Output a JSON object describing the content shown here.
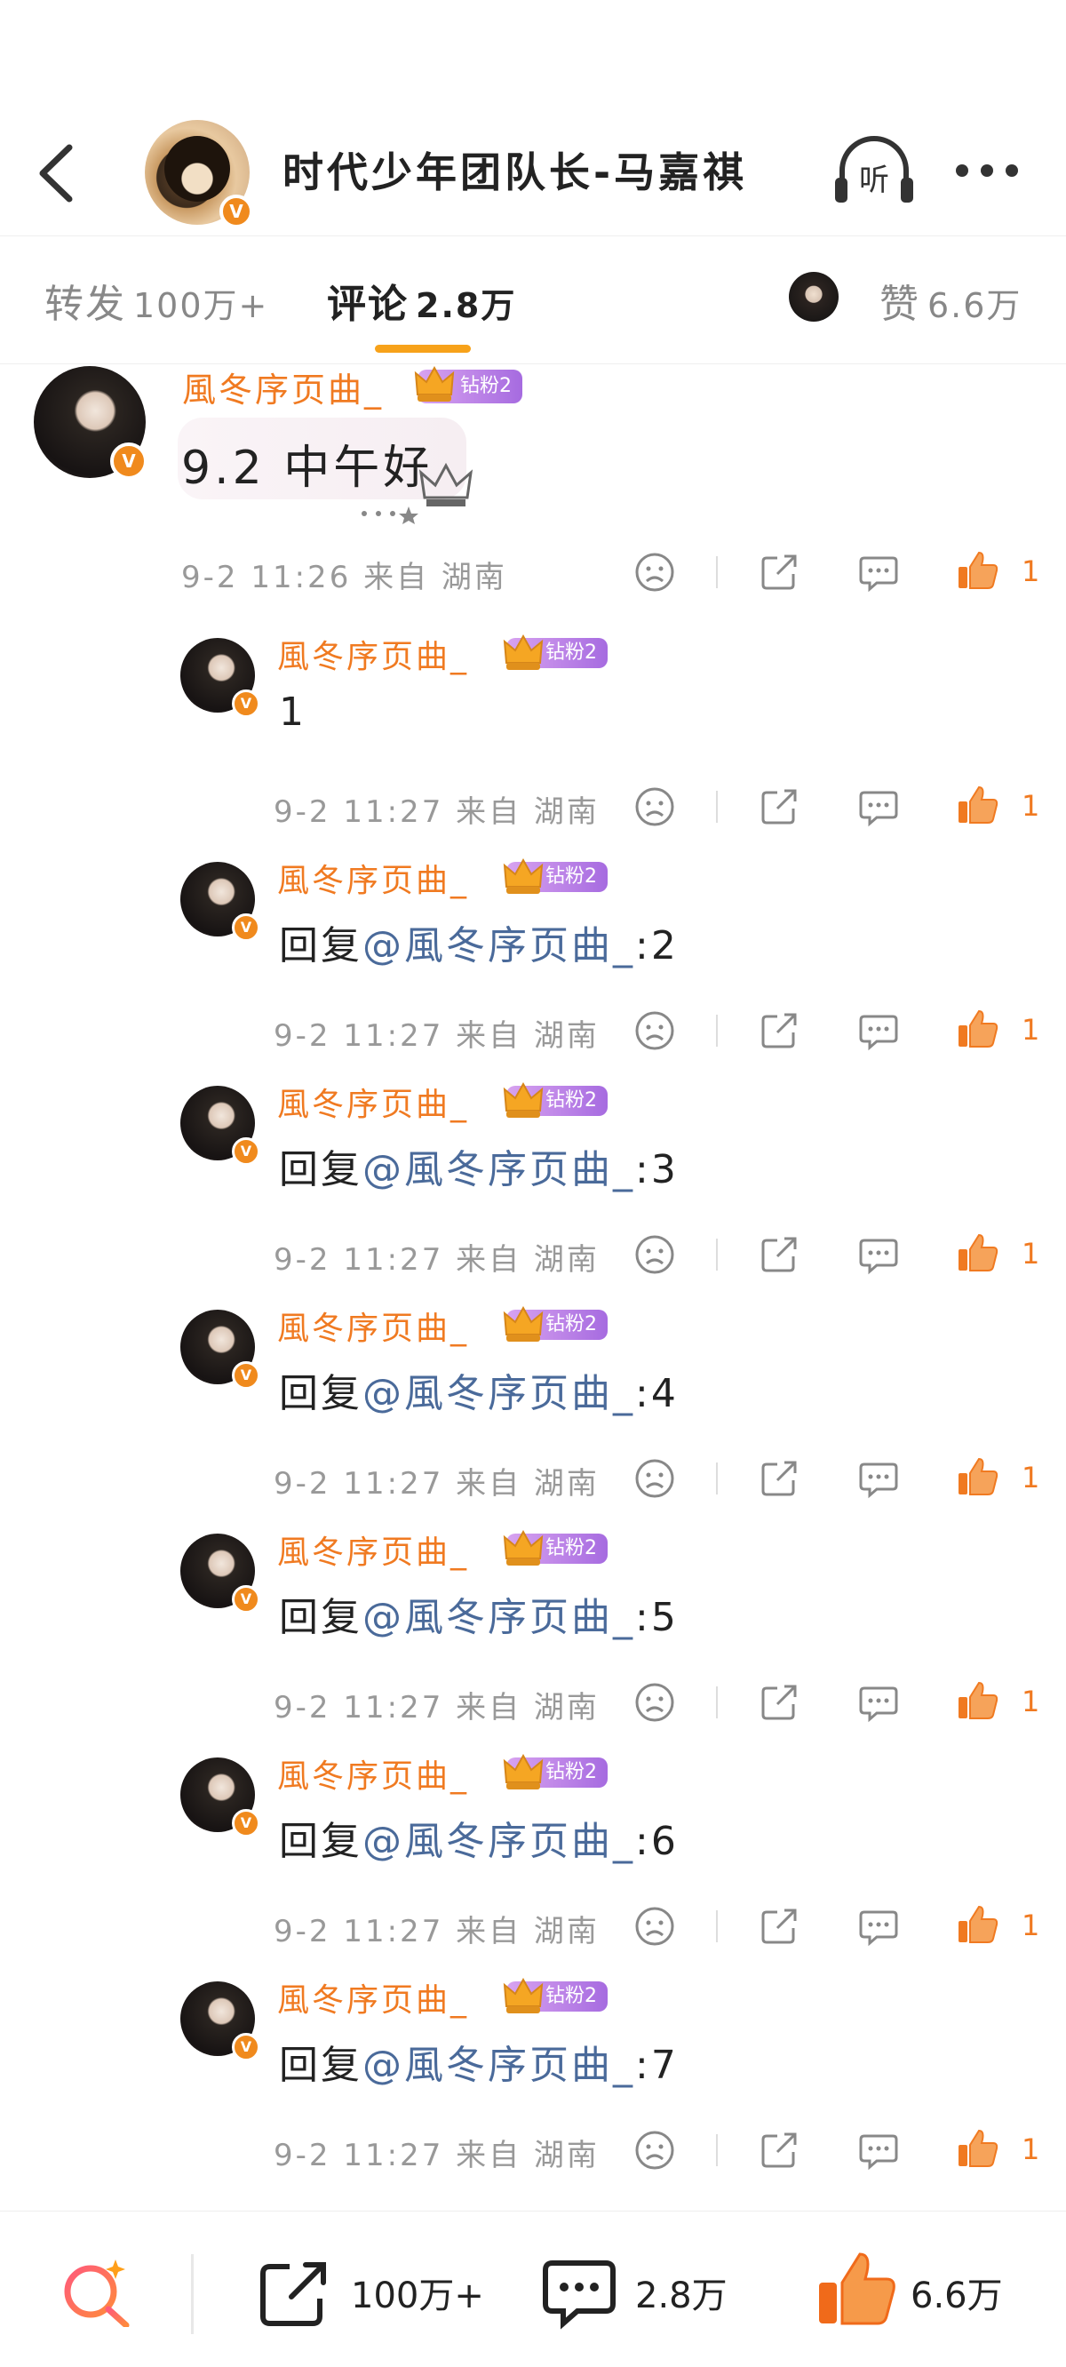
{
  "header": {
    "title": "时代少年团队长-马嘉祺",
    "listen_label": "听",
    "avatar_verified": "V",
    "more_icon": "more-icon"
  },
  "tabs": {
    "repost_label": "转发",
    "repost_count": "100万+",
    "comment_label": "评论",
    "comment_count": "2.8万",
    "like_label": "赞",
    "like_count": "6.6万"
  },
  "main_comment": {
    "username": "風冬序页曲_",
    "fan_badge": "钻粉2",
    "verified": "V",
    "text": "9.2 中午好",
    "meta": "9-2 11:26 来自 湖南",
    "like_count": "1"
  },
  "replies": [
    {
      "username": "風冬序页曲_",
      "fan_badge": "钻粉2",
      "prefix": "",
      "mention": "",
      "suffix": "1",
      "meta": "9-2 11:27 来自 湖南",
      "like_count": "1"
    },
    {
      "username": "風冬序页曲_",
      "fan_badge": "钻粉2",
      "prefix": "回复",
      "mention": "@風冬序页曲_",
      "suffix": ":2",
      "meta": "9-2 11:27 来自 湖南",
      "like_count": "1"
    },
    {
      "username": "風冬序页曲_",
      "fan_badge": "钻粉2",
      "prefix": "回复",
      "mention": "@風冬序页曲_",
      "suffix": ":3",
      "meta": "9-2 11:27 来自 湖南",
      "like_count": "1"
    },
    {
      "username": "風冬序页曲_",
      "fan_badge": "钻粉2",
      "prefix": "回复",
      "mention": "@風冬序页曲_",
      "suffix": ":4",
      "meta": "9-2 11:27 来自 湖南",
      "like_count": "1"
    },
    {
      "username": "風冬序页曲_",
      "fan_badge": "钻粉2",
      "prefix": "回复",
      "mention": "@風冬序页曲_",
      "suffix": ":5",
      "meta": "9-2 11:27 来自 湖南",
      "like_count": "1"
    },
    {
      "username": "風冬序页曲_",
      "fan_badge": "钻粉2",
      "prefix": "回复",
      "mention": "@風冬序页曲_",
      "suffix": ":6",
      "meta": "9-2 11:27 来自 湖南",
      "like_count": "1"
    },
    {
      "username": "風冬序页曲_",
      "fan_badge": "钻粉2",
      "prefix": "回复",
      "mention": "@風冬序页曲_",
      "suffix": ":7",
      "meta": "9-2 11:27 来自 湖南",
      "like_count": "1"
    }
  ],
  "bottom_bar": {
    "repost_count": "100万+",
    "comment_count": "2.8万",
    "like_count": "6.6万"
  },
  "colors": {
    "accent_orange": "#f07a21",
    "tab_underline": "#f7a21a",
    "mention_blue": "#4a6a9a",
    "fan_badge_purple": "#a66be0"
  }
}
